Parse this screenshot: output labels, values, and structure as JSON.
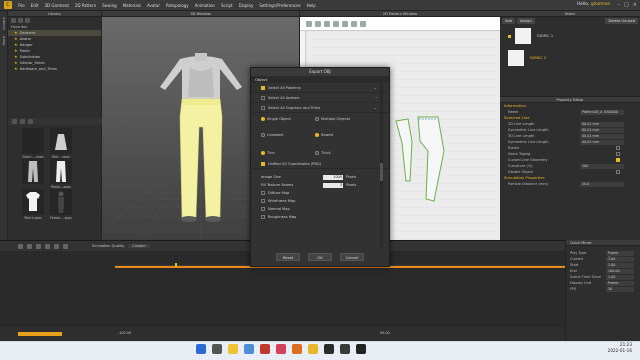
{
  "menubar": {
    "items": [
      "File",
      "Edit",
      "3D Garment",
      "2D Pattern",
      "Sewing",
      "Materials",
      "Avatar",
      "Retopology",
      "Animation",
      "Script",
      "Display",
      "Settings/Preferences",
      "Help"
    ],
    "hello": "Hello,",
    "user": "gloomse"
  },
  "sidebar_tabs": [
    "Library",
    "Store"
  ],
  "library": {
    "title": "Library",
    "favorites_label": "Favorites",
    "favorites": [
      "Garment",
      "Avatar",
      "Hanger",
      "Fabric",
      "Subdivision",
      "Interior_Fabric",
      "Hardware_and_Trims"
    ],
    "thumbs": [
      "Garm....zpac",
      "Skir....zpac",
      "",
      "",
      "Shirt...zpac",
      "Pants...zpac",
      "Tshirt.zpac",
      "Femal....zpac"
    ]
  },
  "window3d": {
    "title": "3D Window"
  },
  "window2d": {
    "title": "2D Pattern Window"
  },
  "fabric": {
    "title": "Fabric",
    "buttons": [
      "Add",
      "Assign",
      "Delete Unused"
    ],
    "items": [
      "FABRIC 1",
      "FABRIC 2"
    ],
    "colors": {
      "fabric1": "#f2f2f2",
      "fabric2": "#f2f2f2"
    }
  },
  "property": {
    "title": "Property Editor",
    "information": "Information",
    "name_label": "Name",
    "name_value": "Pattern2D_0 1000000",
    "selected_line": "Selected Line",
    "rows": [
      {
        "k": "2D Line Length",
        "v": "00.01 mm"
      },
      {
        "k": "Symmetric Line Length",
        "v": "00.01 mm"
      },
      {
        "k": "3D Line Length",
        "v": "00.01 mm"
      },
      {
        "k": "Symmetric Line Length",
        "v": "00.01 mm"
      }
    ],
    "checks": [
      "Elastic",
      "Seam Taping",
      "Curved Line Geometry"
    ],
    "curvature_label": "Curvature (%)",
    "curvature_value": "100",
    "double_object": "Double Object",
    "simulation": "Simulation Properties",
    "particle_label": "Particle Distance (mm)",
    "particle_value": "20.0"
  },
  "dialog": {
    "title": "Export OBJ",
    "section": "Object",
    "options": [
      {
        "label": "Select All Patterns",
        "checked": true
      },
      {
        "label": "Select All Avatars",
        "checked": false
      },
      {
        "label": "Select All Graphics and Trims",
        "checked": false
      }
    ],
    "single_object": "Single Object",
    "multiple_objects": "Multiple Objects",
    "unsewed": "Unsewed",
    "sewed": "Sewed",
    "thin": "Thin",
    "thick": "Thick",
    "unified_uv": "Unified UV Coordinates (PNG)",
    "image_size_label": "Image Size",
    "image_size_value": "1000",
    "image_size_unit": "Pixels",
    "fill_texture_label": "Fill Texture Seams",
    "fill_texture_value": "3",
    "fill_texture_unit": "Pixels",
    "maps": [
      "Diffuse Map",
      "Wireframe Map",
      "Normal Map",
      "Roughness Map"
    ],
    "buttons": {
      "reset": "Reset",
      "ok": "OK",
      "cancel": "Cancel"
    }
  },
  "timeline": {
    "quality_label": "Simulation Quality",
    "quality_value": "Custom",
    "ticks": [
      "-100.00",
      "00.00"
    ],
    "footer_left": "100.00",
    "footer_right": "00.00"
  },
  "quickmirror": {
    "title": "Quick Mirror",
    "rows": [
      {
        "k": "Play Type",
        "v": "Frame Stepping"
      },
      {
        "k": "Current",
        "v": "1.00"
      },
      {
        "k": "Start",
        "v": "1.00"
      },
      {
        "k": "End",
        "v": "100.00"
      },
      {
        "k": "Scene Time Since",
        "v": "1.00"
      },
      {
        "k": "Display Unit",
        "v": "Frame"
      },
      {
        "k": "FPS",
        "v": "30"
      }
    ]
  },
  "taskbar": {
    "time": "21:23",
    "date": "2022-01-16",
    "icon_colors": [
      "#2b6cd4",
      "#555",
      "#f1c232",
      "#4a8fd8",
      "#c0392b",
      "#d43f5a",
      "#e06c1f",
      "#e9b82a",
      "#2b2b2b",
      "#3a3a3a",
      "#222"
    ]
  },
  "accent": "#e8b923",
  "pants_color": "#f4f2a2"
}
